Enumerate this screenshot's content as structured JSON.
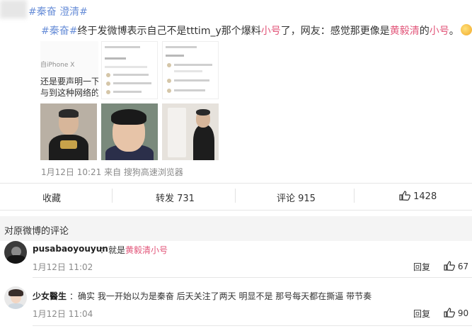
{
  "header": {
    "tags": [
      "#秦奋",
      "澄清#"
    ]
  },
  "post": {
    "text_tag": "#秦奋#",
    "text_part1": "终于发微博表示自己不是tttim_y那个爆料",
    "text_red1": "小号",
    "text_part2": "了，网友：感觉那更像是",
    "text_red2": "黄毅清",
    "text_part3": "的",
    "text_red3": "小号",
    "text_part4": "。",
    "thumb_device": "自iPhone X",
    "thumb_line1": "还是要声明一下",
    "thumb_line2": "与到这种网络的",
    "meta": "1月12日 10:21 来自 搜狗高速浏览器"
  },
  "actions": {
    "favorite": "收藏",
    "repost": "转发 731",
    "comment": "评论 915",
    "like": "1428"
  },
  "comments_section": {
    "title": "对原微博的评论",
    "items": [
      {
        "user": "pusabaoyouyun",
        "sep": "：",
        "text_pre": "就是",
        "text_red": "黄毅清小号",
        "text_post": "",
        "date": "1月12日 11:02",
        "reply": "回复",
        "likes": "67"
      },
      {
        "user": "少女醫生",
        "sep": "：",
        "text_pre": "确实 我一开始以为是秦奋 后天关注了两天 明显不是 那号每天都在撕逼 带节奏",
        "text_red": "",
        "text_post": "",
        "date": "1月12日 11:04",
        "reply": "回复",
        "likes": "90"
      }
    ]
  },
  "colors": {
    "link": "#6a8fd8",
    "highlight": "#e2567a",
    "meta": "#8a8a8a"
  },
  "icons": [
    "like-icon",
    "emoji-icon"
  ]
}
